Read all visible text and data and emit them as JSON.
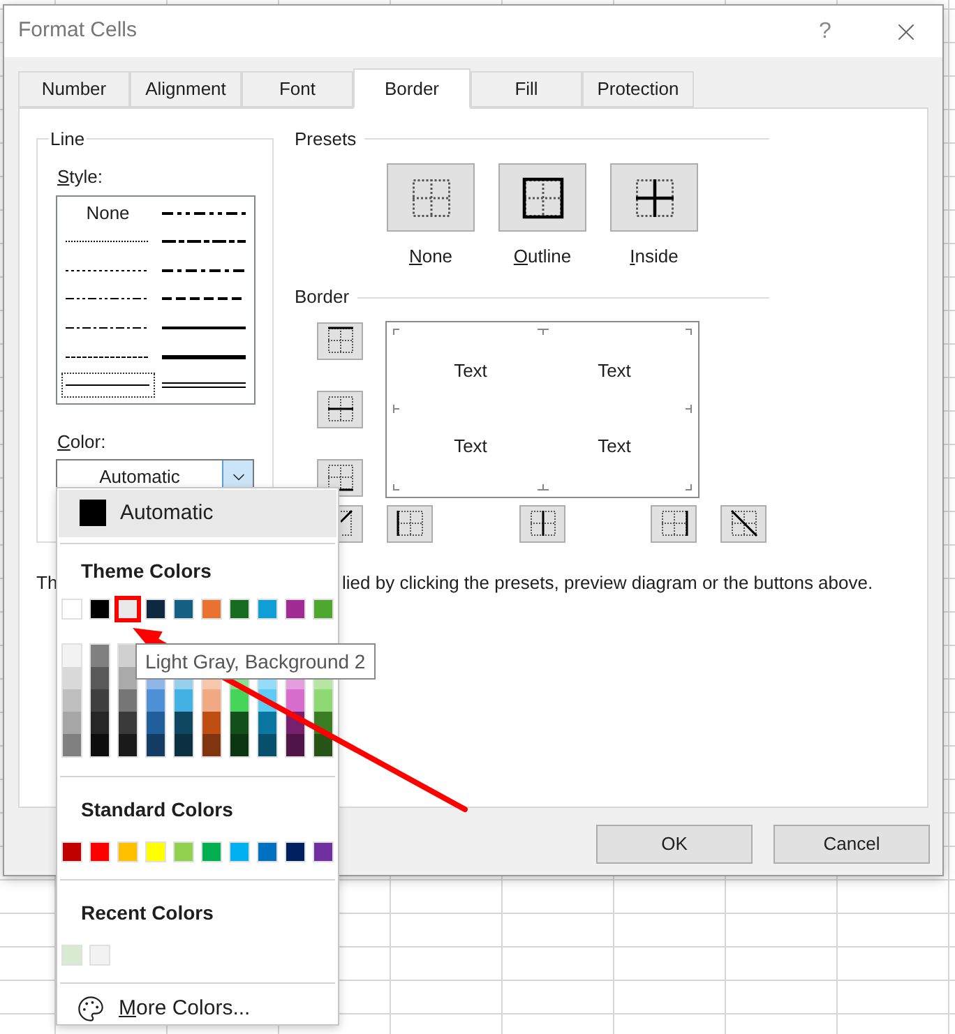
{
  "window": {
    "title": "Format Cells",
    "help": "?"
  },
  "tabs": [
    {
      "label": "Number",
      "selected": false
    },
    {
      "label": "Alignment",
      "selected": false
    },
    {
      "label": "Font",
      "selected": false
    },
    {
      "label": "Border",
      "selected": true
    },
    {
      "label": "Fill",
      "selected": false
    },
    {
      "label": "Protection",
      "selected": false
    }
  ],
  "line": {
    "title": "Line",
    "style_label": "Style:",
    "styles": [
      {
        "kind": "none",
        "label": "None",
        "selected": false
      },
      {
        "kind": "hair",
        "selected": false
      },
      {
        "kind": "dotted",
        "selected": false
      },
      {
        "kind": "dash_dot_dot",
        "selected": false
      },
      {
        "kind": "dash_dot",
        "selected": false
      },
      {
        "kind": "dashed",
        "selected": false
      },
      {
        "kind": "thin",
        "selected": true
      },
      {
        "kind": "medium_dash_dot_dot",
        "selected": false
      },
      {
        "kind": "slant_dash_dot",
        "selected": false
      },
      {
        "kind": "medium_dash_dot",
        "selected": false
      },
      {
        "kind": "medium_dashed",
        "selected": false
      },
      {
        "kind": "medium",
        "selected": false
      },
      {
        "kind": "thick",
        "selected": false
      },
      {
        "kind": "double",
        "selected": false
      }
    ],
    "color_label": "Color:",
    "color_value": "Automatic"
  },
  "presets": {
    "title": "Presets",
    "items": [
      {
        "kind": "none",
        "label": "None"
      },
      {
        "kind": "outline",
        "label": "Outline"
      },
      {
        "kind": "inside",
        "label": "Inside"
      }
    ]
  },
  "border": {
    "title": "Border",
    "preview_texts": [
      "Text",
      "Text",
      "Text",
      "Text"
    ]
  },
  "info_text": [
    "Th",
    "lied by clicking the presets, preview diagram or the buttons above."
  ],
  "buttons": [
    "OK",
    "Cancel"
  ],
  "color_menu": {
    "automatic": "Automatic",
    "theme_title": "Theme Colors",
    "theme_colors": [
      {
        "color": "#ffffff",
        "selected": false
      },
      {
        "color": "#000000",
        "selected": false
      },
      {
        "color": "#e8e8e8",
        "selected": true
      },
      {
        "color": "#0e2841",
        "selected": false
      },
      {
        "color": "#156082",
        "selected": false
      },
      {
        "color": "#e97132",
        "selected": false
      },
      {
        "color": "#196b24",
        "selected": false
      },
      {
        "color": "#0f9ed5",
        "selected": false
      },
      {
        "color": "#a02b93",
        "selected": false
      },
      {
        "color": "#4ea72e",
        "selected": false
      }
    ],
    "shades": [
      {
        "swatches": [
          {
            "color": "#f2f2f2"
          },
          {
            "color": "#d9d9d9"
          },
          {
            "color": "#bfbfbf"
          },
          {
            "color": "#a6a6a6"
          },
          {
            "color": "#808080"
          }
        ]
      },
      {
        "swatches": [
          {
            "color": "#808080"
          },
          {
            "color": "#595959"
          },
          {
            "color": "#404040"
          },
          {
            "color": "#262626"
          },
          {
            "color": "#0d0d0d"
          }
        ]
      },
      {
        "swatches": [
          {
            "color": "#d0d0d0"
          },
          {
            "color": "#aaaaaa"
          },
          {
            "color": "#767676"
          },
          {
            "color": "#3a3a3a"
          },
          {
            "color": "#1a1a1a"
          }
        ]
      },
      {
        "swatches": [
          {
            "color": "#8fb6e6"
          },
          {
            "color": "#4e8fd6"
          },
          {
            "color": "#215f9a"
          },
          {
            "color": "#153d63"
          }
        ]
      },
      {
        "swatches": [
          {
            "color": "#95d0ed"
          },
          {
            "color": "#44b1e4"
          },
          {
            "color": "#0f4761"
          },
          {
            "color": "#0a3041"
          }
        ]
      },
      {
        "swatches": [
          {
            "color": "#f7c7ac"
          },
          {
            "color": "#f1a983"
          },
          {
            "color": "#bf4e14"
          },
          {
            "color": "#803510"
          }
        ]
      },
      {
        "swatches": [
          {
            "color": "#84e291"
          },
          {
            "color": "#47d45a"
          },
          {
            "color": "#124f1a"
          },
          {
            "color": "#0c3512"
          }
        ]
      },
      {
        "swatches": [
          {
            "color": "#94dcf8"
          },
          {
            "color": "#61cbf3"
          },
          {
            "color": "#0b769f"
          },
          {
            "color": "#074f6a"
          }
        ]
      },
      {
        "swatches": [
          {
            "color": "#e59edd"
          },
          {
            "color": "#d86dcd"
          },
          {
            "color": "#77206d"
          },
          {
            "color": "#4f1548"
          }
        ]
      },
      {
        "swatches": [
          {
            "color": "#b5e6a2"
          },
          {
            "color": "#8ed973"
          },
          {
            "color": "#3a7d22"
          },
          {
            "color": "#275317"
          }
        ]
      }
    ],
    "standard_title": "Standard Colors",
    "standard_colors": [
      {
        "color": "#c00000"
      },
      {
        "color": "#ff0000"
      },
      {
        "color": "#ffc000"
      },
      {
        "color": "#ffff00"
      },
      {
        "color": "#92d050"
      },
      {
        "color": "#00b050"
      },
      {
        "color": "#00b0f0"
      },
      {
        "color": "#0070c0"
      },
      {
        "color": "#002060"
      },
      {
        "color": "#7030a0"
      }
    ],
    "recent_title": "Recent Colors",
    "recent_colors": [
      {
        "color": "#d9ead3"
      },
      {
        "color": "#f2f2f2"
      }
    ],
    "more": "More Colors..."
  },
  "tooltip": "Light Gray, Background 2"
}
